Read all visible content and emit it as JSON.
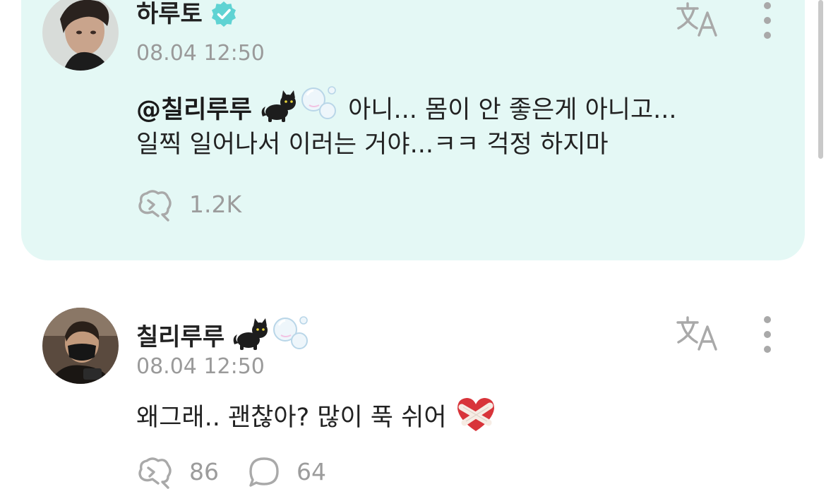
{
  "colors": {
    "highlight_bg": "#e4f8f5",
    "verified_badge": "#5fd3d3",
    "muted_text": "#9a9a9a",
    "icon_gray": "#a9a9a9"
  },
  "post": {
    "author": "하루토",
    "verified": true,
    "timestamp": "08.04 12:50",
    "mention": "@칠리루루",
    "mention_emoji": [
      "cat-emoji",
      "bubbles-emoji"
    ],
    "line1_text": "아니... 몸이 안 좋은게 아니고...",
    "line2_text": "일찍 일어나서 이러는 거야...ㅋㅋ 걱정 하지마",
    "like_count": "1.2K"
  },
  "reply": {
    "author": "칠리루루",
    "author_emoji": [
      "cat-emoji",
      "bubbles-emoji"
    ],
    "timestamp": "08.04 12:50",
    "text": "왜그래.. 괜찮아? 많이 푹 쉬어",
    "text_emoji": "mending-heart-emoji",
    "like_count": "86",
    "comment_count": "64"
  },
  "icons": {
    "translate": "translate-icon",
    "more": "more-vertical-icon",
    "like": "like-icon",
    "comment": "comment-icon"
  }
}
